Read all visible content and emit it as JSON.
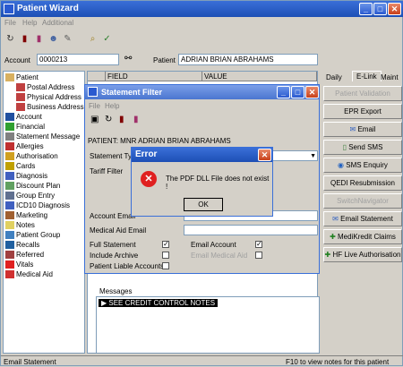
{
  "window": {
    "title": "Patient Wizard"
  },
  "menu": {
    "file": "File",
    "help": "Help",
    "additional": "Additional"
  },
  "header": {
    "account_label": "Account",
    "account_value": "0000213",
    "patient_label": "Patient",
    "patient_value": "ADRIAN BRIAN ABRAHAMS"
  },
  "grid": {
    "col_field": "FIELD",
    "col_value": "VALUE"
  },
  "tree": {
    "items": [
      "Patient",
      "Postal Address",
      "Physical Address",
      "Business Address",
      "Account",
      "Financial",
      "Statement Message",
      "Allergies",
      "Authorisation",
      "Cards",
      "Diagnosis",
      "Discount Plan",
      "Group Entry",
      "ICD10 Diagnosis",
      "Marketing",
      "Notes",
      "Patient Group",
      "Recalls",
      "Referred",
      "Vitals",
      "Medical Aid"
    ]
  },
  "tabs": {
    "daily": "Daily",
    "elink": "E-Link",
    "maint": "Maint"
  },
  "side_buttons": [
    "Patient Validation",
    "EPR Export",
    "Email",
    "Send SMS",
    "SMS Enquiry",
    "QEDI Resubmission",
    "SwitchNavigator",
    "Email Statement",
    "MediKredit Claims",
    "HF Live Authorisation"
  ],
  "statement_filter": {
    "title": "Statement Filter",
    "menu_file": "File",
    "menu_help": "Help",
    "patient_line": "PATIENT: MNR ADRIAN BRIAN ABRAHAMS",
    "statement_type_label": "Statement Type",
    "tariff_filter_label": "Tariff Filter",
    "account_email_label": "Account Email",
    "medical_aid_email_label": "Medical Aid Email",
    "full_statement": "Full Statement",
    "include_archive": "Include Archive",
    "patient_liable": "Patient Liable Accounts",
    "email_account": "Email Account",
    "email_medical_aid": "Email Medical Aid"
  },
  "error_dialog": {
    "title": "Error",
    "message": "The PDF DLL File does not exist !",
    "ok": "OK"
  },
  "messages": {
    "label": "Messages",
    "item": "SEE CREDIT CONTROL NOTES"
  },
  "status": {
    "left": "Email Statement",
    "right": "F10 to view notes for this patient"
  }
}
